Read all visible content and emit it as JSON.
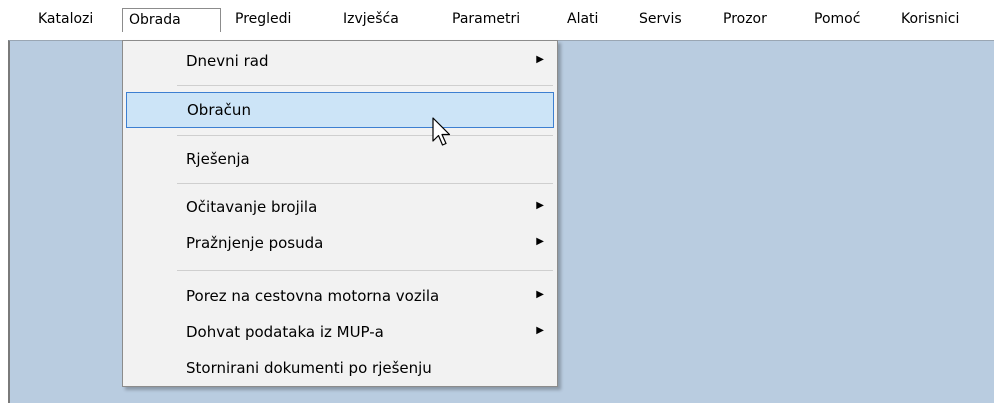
{
  "menubar": {
    "items": [
      {
        "label": "Katalozi"
      },
      {
        "label": "Obrada"
      },
      {
        "label": "Pregledi"
      },
      {
        "label": "Izvješća"
      },
      {
        "label": "Parametri"
      },
      {
        "label": "Alati"
      },
      {
        "label": "Servis"
      },
      {
        "label": "Prozor"
      },
      {
        "label": "Pomoć"
      },
      {
        "label": "Korisnici"
      }
    ],
    "open_menu": "Obrada"
  },
  "dropdown": {
    "items": [
      {
        "label": "Dnevni rad",
        "submenu": true
      },
      {
        "label": "Obračun",
        "submenu": false,
        "highlighted": true
      },
      {
        "label": "Rješenja",
        "submenu": false
      },
      {
        "label": "Očitavanje brojila",
        "submenu": true
      },
      {
        "label": "Pražnjenje posuda",
        "submenu": true
      },
      {
        "label": "Porez na cestovna motorna vozila",
        "submenu": true
      },
      {
        "label": "Dohvat podataka iz MUP-a",
        "submenu": true
      },
      {
        "label": "Stornirani dokumenti po rješenju",
        "submenu": false
      }
    ],
    "submenu_arrow": "▶"
  },
  "colors": {
    "workspace_bg": "#b9cce0",
    "highlight_bg": "#cce4f7",
    "highlight_border": "#3d7fd1",
    "menu_bg": "#f2f2f2"
  },
  "icons": {
    "cursor": "arrow-pointer-icon",
    "submenu": "triangle-right-icon"
  }
}
